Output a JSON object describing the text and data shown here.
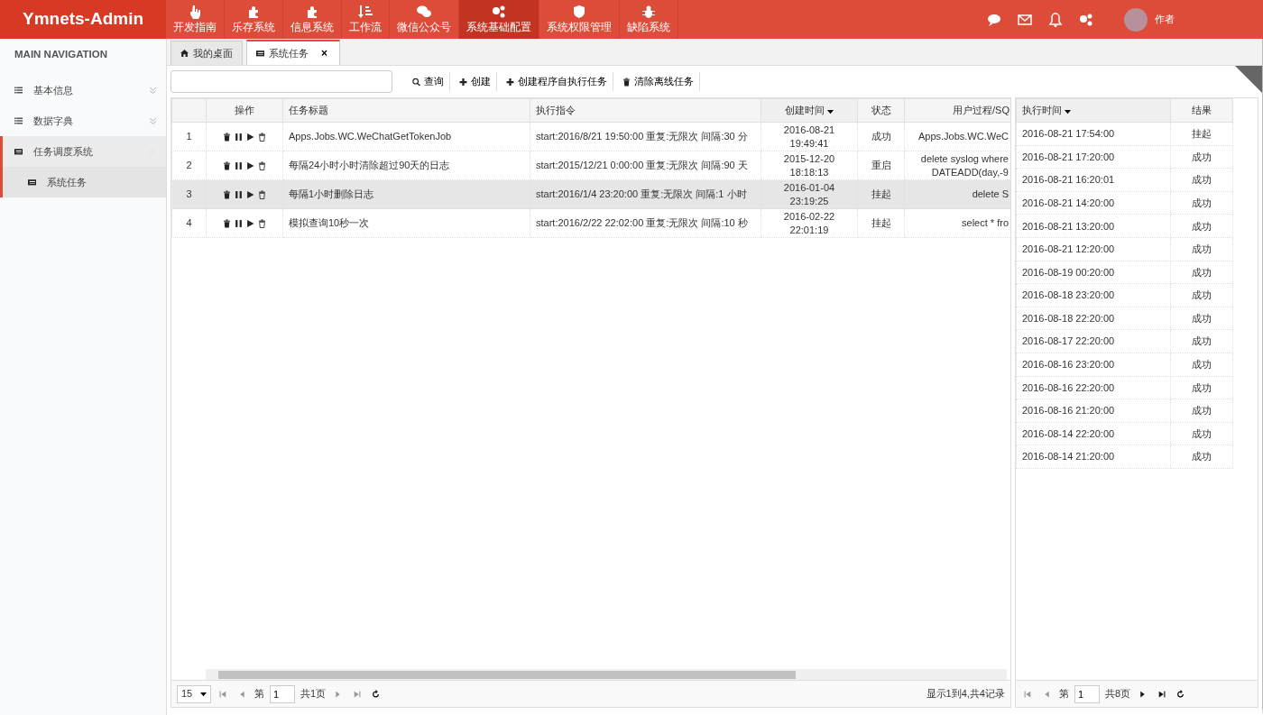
{
  "brand": "Ymnets-Admin",
  "top_nav": [
    {
      "label": "开发指南",
      "selected": false
    },
    {
      "label": "乐存系统",
      "selected": false
    },
    {
      "label": "信息系统",
      "selected": false
    },
    {
      "label": "工作流",
      "selected": false
    },
    {
      "label": "微信公众号",
      "selected": false
    },
    {
      "label": "系统基础配置",
      "selected": true
    },
    {
      "label": "系统权限管理",
      "selected": false
    },
    {
      "label": "缺陷系统",
      "selected": false
    }
  ],
  "user": {
    "name": "作者"
  },
  "sidebar": {
    "header": "MAIN NAVIGATION",
    "items": [
      {
        "label": "基本信息",
        "expanded": false,
        "selected": false
      },
      {
        "label": "数据字典",
        "expanded": false,
        "selected": false
      },
      {
        "label": "任务调度系统",
        "expanded": true,
        "selected": true,
        "children": [
          {
            "label": "系统任务",
            "selected": true
          }
        ]
      }
    ]
  },
  "tabs": [
    {
      "label": "我的桌面",
      "selected": false,
      "closable": false
    },
    {
      "label": "系统任务",
      "selected": true,
      "closable": true,
      "close": "×"
    }
  ],
  "toolbar": {
    "buttons": [
      "查询",
      "创建",
      "创建程序自执行任务",
      "清除离线任务"
    ]
  },
  "task_table": {
    "columns": [
      {
        "sorted": false
      },
      {
        "label": "操作",
        "sorted": false
      },
      {
        "label": "任务标题",
        "sorted": false
      },
      {
        "label": "执行指令",
        "sorted": false
      },
      {
        "label": "创建时间",
        "sorted": true
      },
      {
        "label": "状态",
        "sorted": false
      },
      {
        "label": "用户过程/SQ",
        "sorted": false
      }
    ],
    "rows": [
      {
        "index": "1",
        "title": "Apps.Jobs.WC.WeChatGetTokenJob",
        "command": "start:2016/8/21 19:50:00 重复:无限次 间隔:30 分",
        "created": [
          "2016-08-21",
          "19:49:41"
        ],
        "status": "成功",
        "procedure": [
          "Apps.Jobs.WC.WeC"
        ],
        "selected": false
      },
      {
        "index": "2",
        "title": "每隔24小时小时清除超过90天的日志",
        "command": "start:2015/12/21 0:00:00 重复:无限次 间隔:90 天",
        "created": [
          "2015-12-20",
          "18:18:13"
        ],
        "status": "重启",
        "procedure": [
          "delete syslog where",
          "DATEADD(day,-9"
        ],
        "selected": false
      },
      {
        "index": "3",
        "title": "每隔1小时删除日志",
        "command": "start:2016/1/4 23:20:00 重复:无限次 间隔:1 小时",
        "created": [
          "2016-01-04",
          "23:19:25"
        ],
        "status": "挂起",
        "procedure": [
          "delete S"
        ],
        "selected": true
      },
      {
        "index": "4",
        "title": "模拟查询10秒一次",
        "command": "start:2016/2/22 22:02:00 重复:无限次 间隔:10 秒",
        "created": [
          "2016-02-22",
          "22:01:19"
        ],
        "status": "挂起",
        "procedure": [
          "select * fro"
        ],
        "selected": false
      }
    ],
    "pager": {
      "page_size": "15",
      "page_label": "第",
      "page": "1",
      "total_pages": "共1页",
      "first_disabled": true,
      "next_disabled": true,
      "summary": "显示1到4,共4记录"
    }
  },
  "log_table": {
    "columns": [
      {
        "label": "执行时间",
        "sorted": true
      },
      {
        "label": "结果",
        "sorted": false
      }
    ],
    "rows": [
      {
        "time": "2016-08-21 17:54:00",
        "result": "挂起"
      },
      {
        "time": "2016-08-21 17:20:00",
        "result": "成功"
      },
      {
        "time": "2016-08-21 16:20:01",
        "result": "成功"
      },
      {
        "time": "2016-08-21 14:20:00",
        "result": "成功"
      },
      {
        "time": "2016-08-21 13:20:00",
        "result": "成功"
      },
      {
        "time": "2016-08-21 12:20:00",
        "result": "成功"
      },
      {
        "time": "2016-08-19 00:20:00",
        "result": "成功"
      },
      {
        "time": "2016-08-18 23:20:00",
        "result": "成功"
      },
      {
        "time": "2016-08-18 22:20:00",
        "result": "成功"
      },
      {
        "time": "2016-08-17 22:20:00",
        "result": "成功"
      },
      {
        "time": "2016-08-16 23:20:00",
        "result": "成功"
      },
      {
        "time": "2016-08-16 22:20:00",
        "result": "成功"
      },
      {
        "time": "2016-08-16 21:20:00",
        "result": "成功"
      },
      {
        "time": "2016-08-14 22:20:00",
        "result": "成功"
      },
      {
        "time": "2016-08-14 21:20:00",
        "result": "成功"
      }
    ],
    "pager": {
      "page_label": "第",
      "page": "1",
      "total_pages": "共8页",
      "first_disabled": true,
      "next_disabled": false
    }
  }
}
